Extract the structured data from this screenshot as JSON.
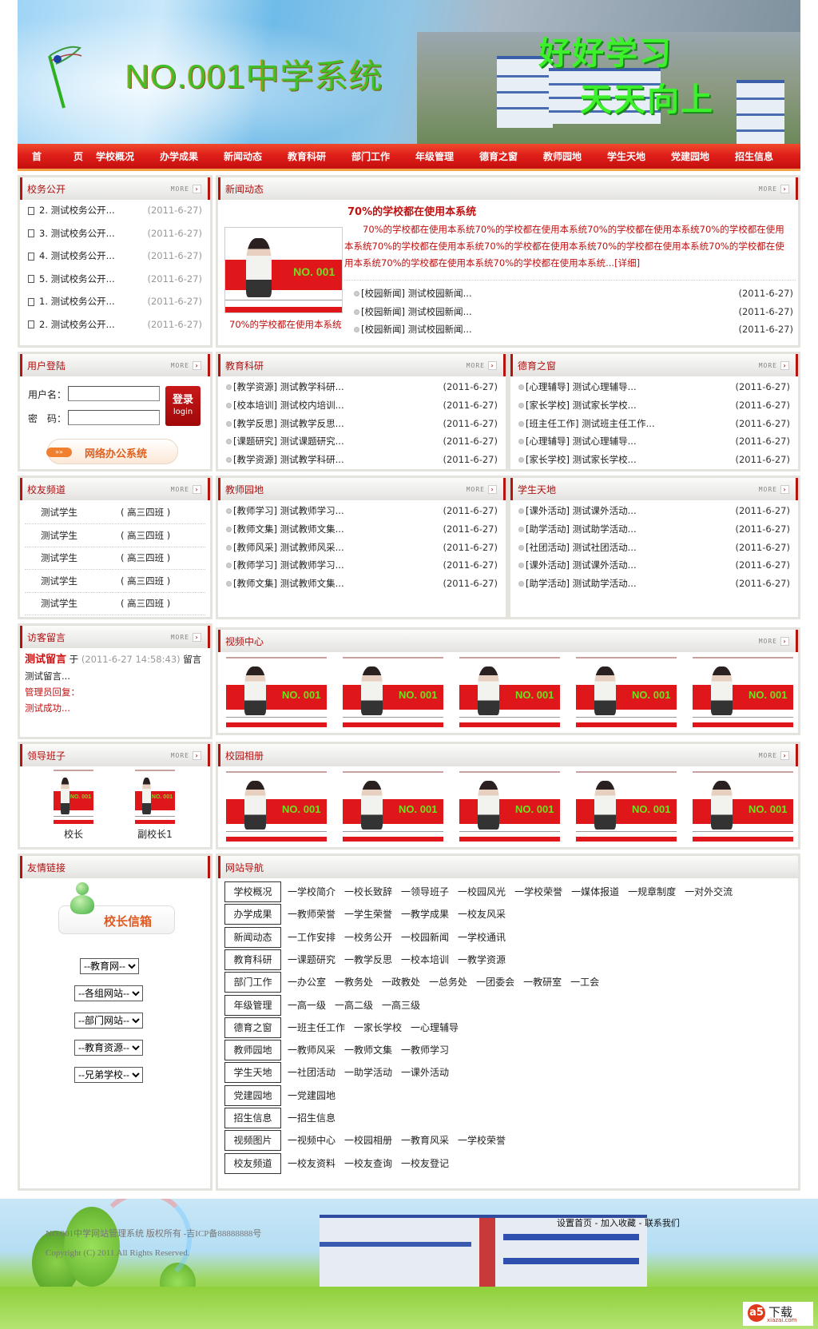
{
  "banner": {
    "title": "NO.001中学系统",
    "slogan_line1": "好好学习",
    "slogan_line2": "天天向上"
  },
  "nav": [
    "首　页",
    "学校概况",
    "办学成果",
    "新闻动态",
    "教育科研",
    "部门工作",
    "年级管理",
    "德育之窗",
    "教师园地",
    "学生天地",
    "党建园地",
    "招生信息"
  ],
  "more_label": "MORE",
  "school_affairs": {
    "title": "校务公开",
    "items": [
      {
        "label": "2. 测试校务公开...",
        "date": "(2011-6-27)"
      },
      {
        "label": "3. 测试校务公开...",
        "date": "(2011-6-27)"
      },
      {
        "label": "4. 测试校务公开...",
        "date": "(2011-6-27)"
      },
      {
        "label": "5. 测试校务公开...",
        "date": "(2011-6-27)"
      },
      {
        "label": "1. 测试校务公开...",
        "date": "(2011-6-27)"
      },
      {
        "label": "2. 测试校务公开...",
        "date": "(2011-6-27)"
      }
    ]
  },
  "news": {
    "title": "新闻动态",
    "headline": "70%的学校都在使用本系统",
    "body": "70%的学校都在使用本系统70%的学校都在使用本系统70%的学校都在使用本系统70%的学校都在使用本系统70%的学校都在使用本系统70%的学校都在使用本系统70%的学校都在使用本系统70%的学校都在使用本系统70%的学校都在使用本系统70%的学校都在使用本系统...",
    "detail_link": "[详细]",
    "image_caption": "70%的学校都在使用本系统",
    "thumb_text": "NO. 001",
    "items": [
      {
        "label": "[校园新闻] 测试校园新闻...",
        "date": "(2011-6-27)"
      },
      {
        "label": "[校园新闻] 测试校园新闻...",
        "date": "(2011-6-27)"
      },
      {
        "label": "[校园新闻] 测试校园新闻...",
        "date": "(2011-6-27)"
      }
    ]
  },
  "login": {
    "title": "用户登陆",
    "username_label": "用户名：",
    "password_label": "密　码：",
    "username_value": "",
    "password_value": "",
    "login_cn": "登录",
    "login_en": "login",
    "office_button": "网络办公系统"
  },
  "research": {
    "title": "教育科研",
    "items": [
      {
        "label": "[教学资源] 测试教学科研...",
        "date": "(2011-6-27)"
      },
      {
        "label": "[校本培训] 测试校内培训...",
        "date": "(2011-6-27)"
      },
      {
        "label": "[教学反思] 测试教学反思...",
        "date": "(2011-6-27)"
      },
      {
        "label": "[课题研究] 测试课题研究...",
        "date": "(2011-6-27)"
      },
      {
        "label": "[教学资源] 测试教学科研...",
        "date": "(2011-6-27)"
      }
    ]
  },
  "moral": {
    "title": "德育之窗",
    "items": [
      {
        "label": "[心理辅导] 测试心理辅导...",
        "date": "(2011-6-27)"
      },
      {
        "label": "[家长学校] 测试家长学校...",
        "date": "(2011-6-27)"
      },
      {
        "label": "[班主任工作] 测试班主任工作...",
        "date": "(2011-6-27)"
      },
      {
        "label": "[心理辅导] 测试心理辅导...",
        "date": "(2011-6-27)"
      },
      {
        "label": "[家长学校] 测试家长学校...",
        "date": "(2011-6-27)"
      }
    ]
  },
  "alumni": {
    "title": "校友频道",
    "items": [
      {
        "name": "测试学生",
        "cls": "( 高三四班 )"
      },
      {
        "name": "测试学生",
        "cls": "( 高三四班 )"
      },
      {
        "name": "测试学生",
        "cls": "( 高三四班 )"
      },
      {
        "name": "测试学生",
        "cls": "( 高三四班 )"
      },
      {
        "name": "测试学生",
        "cls": "( 高三四班 )"
      }
    ]
  },
  "teachers": {
    "title": "教师园地",
    "items": [
      {
        "label": "[教师学习] 测试教师学习...",
        "date": "(2011-6-27)"
      },
      {
        "label": "[教师文集] 测试教师文集...",
        "date": "(2011-6-27)"
      },
      {
        "label": "[教师风采] 测试教师风采...",
        "date": "(2011-6-27)"
      },
      {
        "label": "[教师学习] 测试教师学习...",
        "date": "(2011-6-27)"
      },
      {
        "label": "[教师文集] 测试教师文集...",
        "date": "(2011-6-27)"
      }
    ]
  },
  "students": {
    "title": "学生天地",
    "items": [
      {
        "label": "[课外活动] 测试课外活动...",
        "date": "(2011-6-27)"
      },
      {
        "label": "[助学活动] 测试助学活动...",
        "date": "(2011-6-27)"
      },
      {
        "label": "[社团活动] 测试社团活动...",
        "date": "(2011-6-27)"
      },
      {
        "label": "[课外活动] 测试课外活动...",
        "date": "(2011-6-27)"
      },
      {
        "label": "[助学活动] 测试助学活动...",
        "date": "(2011-6-27)"
      }
    ]
  },
  "guestbook": {
    "title": "访客留言",
    "author": "测试留言",
    "at": "于",
    "time": "(2011-6-27 14:58:43)",
    "tail": "留言",
    "content": "测试留言...",
    "reply_label": "管理员回复：",
    "reply": "测试成功..."
  },
  "video": {
    "title": "视频中心",
    "count": 5
  },
  "leaders": {
    "title": "领导班子",
    "items": [
      {
        "caption": "校长"
      },
      {
        "caption": "副校长1"
      }
    ]
  },
  "album": {
    "title": "校园相册",
    "count": 5
  },
  "links": {
    "title": "友情链接",
    "mailbox": "校长信箱",
    "selects": [
      "--教育网--",
      "--各组网站--",
      "--部门网站--",
      "--教育资源--",
      "--兄弟学校--"
    ]
  },
  "sitenav": {
    "title": "网站导航",
    "rows": [
      {
        "cat": "学校概况",
        "links": [
          "一学校简介",
          "一校长致辞",
          "一领导班子",
          "一校园风光",
          "一学校荣誉",
          "一媒体报道",
          "一规章制度",
          "一对外交流"
        ]
      },
      {
        "cat": "办学成果",
        "links": [
          "一教师荣誉",
          "一学生荣誉",
          "一教学成果",
          "一校友风采"
        ]
      },
      {
        "cat": "新闻动态",
        "links": [
          "一工作安排",
          "一校务公开",
          "一校园新闻",
          "一学校通讯"
        ]
      },
      {
        "cat": "教育科研",
        "links": [
          "一课题研究",
          "一教学反思",
          "一校本培训",
          "一教学资源"
        ]
      },
      {
        "cat": "部门工作",
        "links": [
          "一办公室",
          "一教务处",
          "一政教处",
          "一总务处",
          "一团委会",
          "一教研室",
          "一工会"
        ]
      },
      {
        "cat": "年级管理",
        "links": [
          "一高一级",
          "一高二级",
          "一高三级"
        ]
      },
      {
        "cat": "德育之窗",
        "links": [
          "一班主任工作",
          "一家长学校",
          "一心理辅导"
        ]
      },
      {
        "cat": "教师园地",
        "links": [
          "一教师风采",
          "一教师文集",
          "一教师学习"
        ]
      },
      {
        "cat": "学生天地",
        "links": [
          "一社团活动",
          "一助学活动",
          "一课外活动"
        ]
      },
      {
        "cat": "党建园地",
        "links": [
          "一党建园地"
        ]
      },
      {
        "cat": "招生信息",
        "links": [
          "一招生信息"
        ]
      },
      {
        "cat": "视频图片",
        "links": [
          "一视频中心",
          "一校园相册",
          "一教育风采",
          "一学校荣誉"
        ]
      },
      {
        "cat": "校友频道",
        "links": [
          "一校友资料",
          "一校友查询",
          "一校友登记"
        ]
      }
    ]
  },
  "footer": {
    "copyright": "NO.001中学网站管理系统 版权所有 -吉ICP备88888888号",
    "rights": "Copyright (C) 2011 All Rights Reserved.",
    "set_home": "设置首页",
    "add_fav": "加入收藏",
    "contact": "联系我们",
    "sep": " - ",
    "watermark": "下载",
    "watermark_sub": "xiazai.com"
  }
}
